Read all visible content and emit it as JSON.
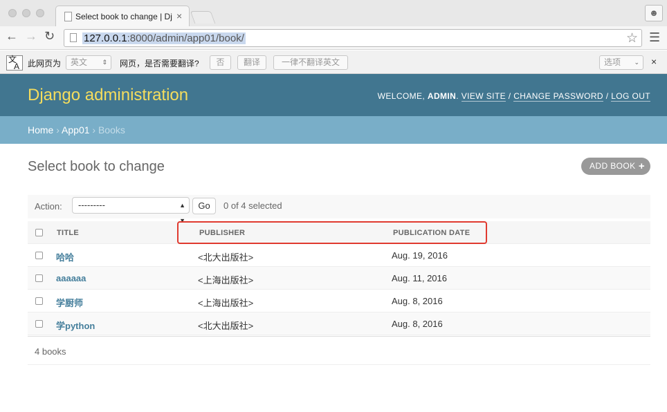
{
  "browser": {
    "tab_title": "Select book to change | Dja",
    "url_host": "127.0.0.1",
    "url_rest": ":8000/admin/app01/book/"
  },
  "translate_bar": {
    "lead": "此网页为",
    "language": "英文",
    "question": "网页，是否需要翻译?",
    "no_label": "否",
    "translate_label": "翻译",
    "never_label": "一律不翻译英文",
    "options_label": "选项"
  },
  "header": {
    "branding": "Django administration",
    "welcome": "WELCOME, ",
    "username": "ADMIN",
    "view_site": "VIEW SITE",
    "change_password": "CHANGE PASSWORD",
    "log_out": "LOG OUT"
  },
  "breadcrumbs": {
    "home": "Home",
    "app": "App01",
    "current": "Books"
  },
  "content": {
    "title": "Select book to change",
    "add_button": "ADD BOOK"
  },
  "actions": {
    "label": "Action:",
    "select_value": "---------",
    "go_label": "Go",
    "selected_text": "0 of 4 selected"
  },
  "table": {
    "headers": [
      "TITLE",
      "PUBLISHER",
      "PUBLICATION DATE"
    ],
    "rows": [
      {
        "title": "哈哈",
        "publisher": "<北大出版社>",
        "date": "Aug. 19, 2016"
      },
      {
        "title": "aaaaaa",
        "publisher": "<上海出版社>",
        "date": "Aug. 11, 2016"
      },
      {
        "title": "学厨师",
        "publisher": "<上海出版社>",
        "date": "Aug. 8, 2016"
      },
      {
        "title": "学python",
        "publisher": "<北大出版社>",
        "date": "Aug. 8, 2016"
      }
    ]
  },
  "paginator": {
    "text": "4 books"
  },
  "colors": {
    "header_bg": "#417690",
    "breadcrumbs_bg": "#79aec8",
    "branding": "#f5dd5d",
    "link": "#447e9b",
    "highlight": "#e03a2f"
  }
}
